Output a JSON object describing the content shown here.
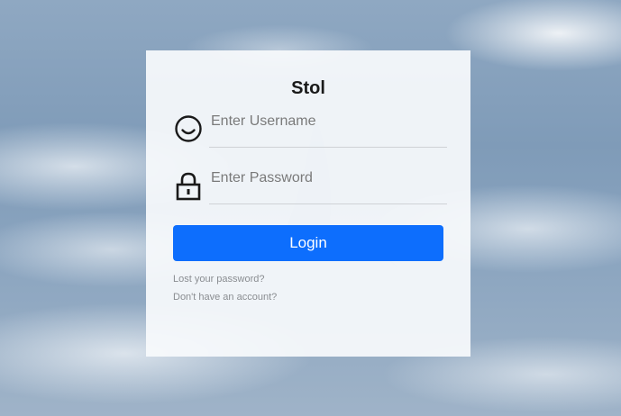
{
  "app": {
    "title": "Stol"
  },
  "form": {
    "username": {
      "placeholder": "Enter Username",
      "value": ""
    },
    "password": {
      "placeholder": "Enter Password",
      "value": ""
    },
    "login_label": "Login",
    "lost_password_label": "Lost your password?",
    "signup_label": "Don't have an account?"
  },
  "icons": {
    "username": "smiley-face-icon",
    "password": "padlock-icon"
  },
  "colors": {
    "accent": "#0d6efd",
    "card_background": "#f8fafc",
    "link_text": "#8a8d91"
  }
}
